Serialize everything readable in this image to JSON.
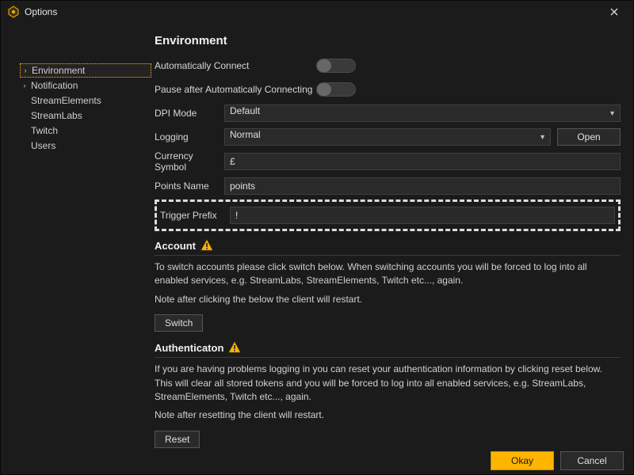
{
  "window": {
    "title": "Options"
  },
  "sidebar": {
    "items": [
      {
        "label": "Environment",
        "has_children": true,
        "active": true
      },
      {
        "label": "Notification",
        "has_children": true,
        "active": false
      },
      {
        "label": "StreamElements",
        "has_children": false,
        "active": false
      },
      {
        "label": "StreamLabs",
        "has_children": false,
        "active": false
      },
      {
        "label": "Twitch",
        "has_children": false,
        "active": false
      },
      {
        "label": "Users",
        "has_children": false,
        "active": false
      }
    ]
  },
  "main": {
    "heading": "Environment",
    "auto_connect_label": "Automatically Connect",
    "pause_after_label": "Pause after Automatically Connecting",
    "dpi": {
      "label": "DPI Mode",
      "value": "Default"
    },
    "logging": {
      "label": "Logging",
      "value": "Normal",
      "open_btn": "Open"
    },
    "currency": {
      "label": "Currency Symbol",
      "value": "£"
    },
    "points": {
      "label": "Points Name",
      "value": "points"
    },
    "trigger": {
      "label": "Trigger Prefix",
      "value": "!"
    },
    "account": {
      "title": "Account",
      "text1": "To switch accounts please click switch below. When switching accounts you will be forced to log into all enabled services, e.g. StreamLabs, StreamElements, Twitch etc..., again.",
      "text2": "Note after clicking the below the client will restart.",
      "switch_btn": "Switch"
    },
    "auth": {
      "title": "Authenticaton",
      "text1": "If you are having problems logging in you can reset your authentication information by clicking reset below. This will clear all stored tokens and you will be forced to log into all enabled services, e.g. StreamLabs, StreamElements, Twitch etc..., again.",
      "text2": "Note after resetting the client will restart.",
      "reset_btn": "Reset"
    }
  },
  "footer": {
    "ok": "Okay",
    "cancel": "Cancel"
  }
}
